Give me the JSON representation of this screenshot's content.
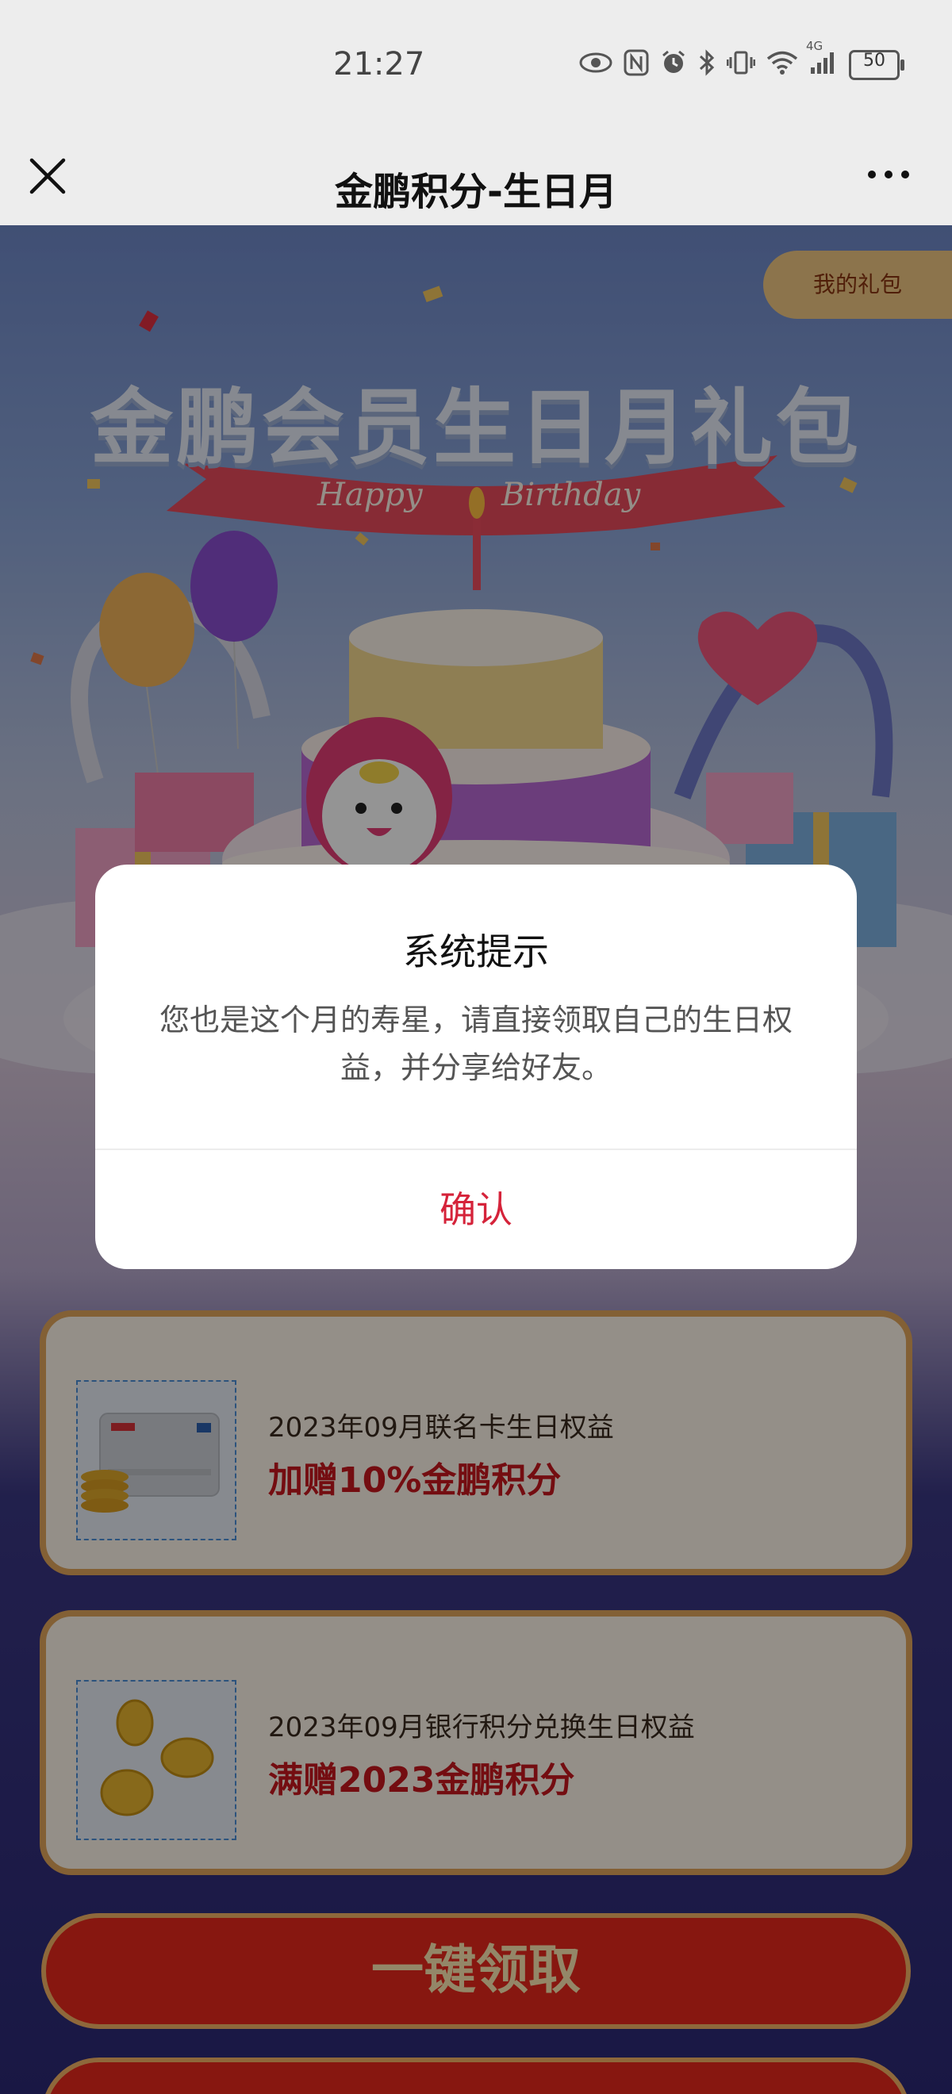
{
  "status_bar": {
    "time": "21:27",
    "icons": [
      "eye-icon",
      "nfc-icon",
      "alarm-icon",
      "bluetooth-icon",
      "vibrate-icon",
      "wifi-icon",
      "signal-icon"
    ],
    "network": "4G",
    "battery": "50"
  },
  "nav": {
    "title": "金鹏积分-生日月"
  },
  "banner": {
    "my_gift": "我的礼包",
    "title": "金鹏会员生日月礼包",
    "ribbon_left": "Happy",
    "ribbon_right": "Birthday"
  },
  "cards": [
    {
      "subtitle": "2023年09月联名卡生日权益",
      "title": "加赠10%金鹏积分"
    },
    {
      "subtitle": "2023年09月银行积分兑换生日权益",
      "title": "满赠2023金鹏积分"
    }
  ],
  "claim_button": "一键领取",
  "dialog": {
    "title": "系统提示",
    "message": "您也是这个月的寿星，请直接领取自己的生日权益，并分享给好友。",
    "confirm": "确认"
  },
  "colors": {
    "accent_red": "#c8171e",
    "confirm_red": "#d5233a",
    "card_border": "#e2a65c",
    "page_bottom": "#2c2976"
  }
}
